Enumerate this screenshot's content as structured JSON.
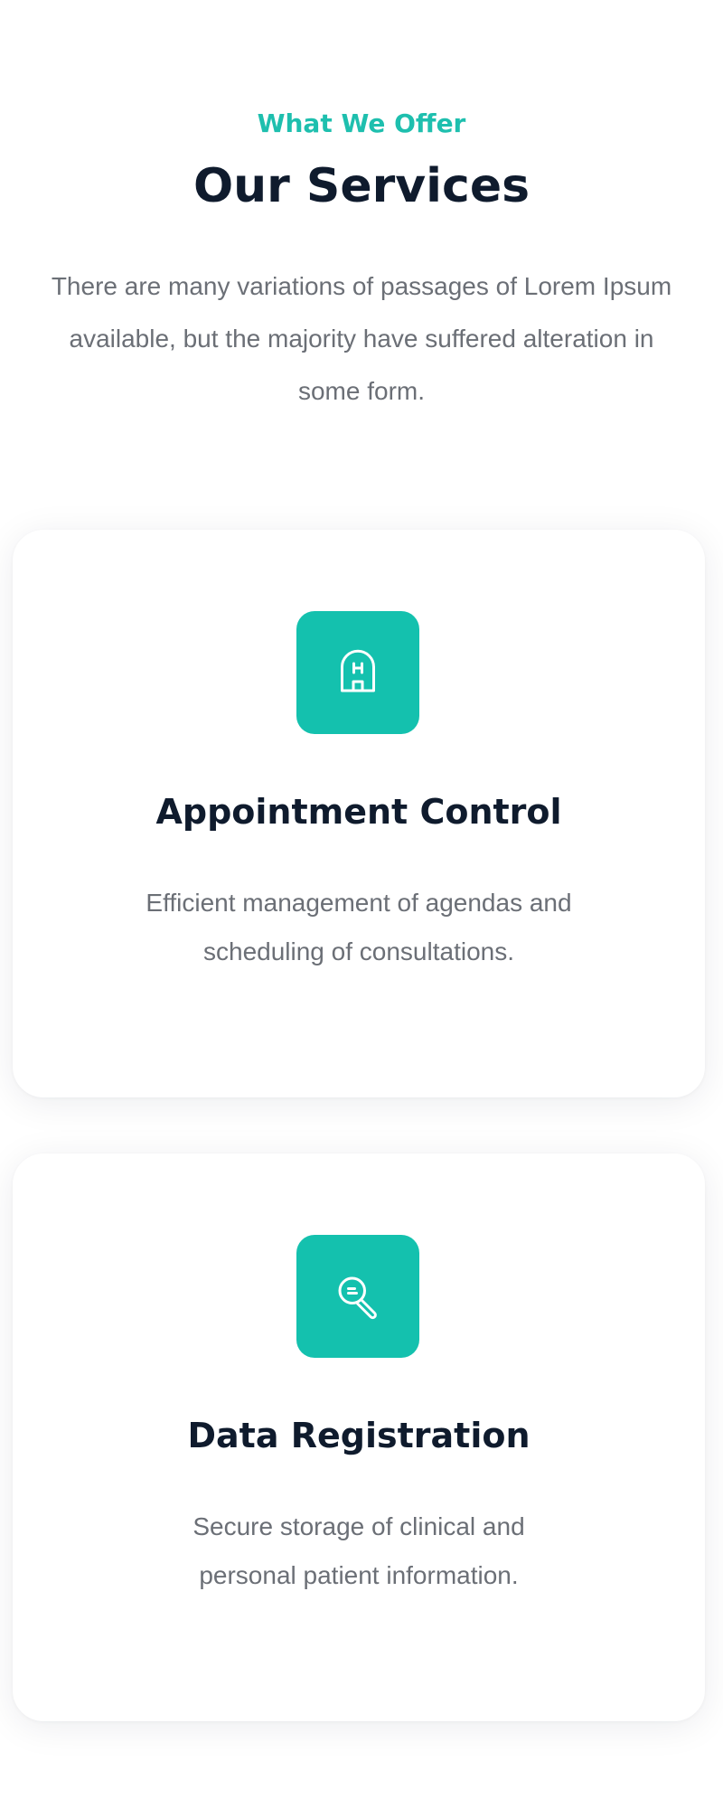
{
  "header": {
    "eyebrow": "What We Offer",
    "title": "Our Services",
    "intro": "There are many variations of passages of Lorem Ipsum available, but the majority have suffered alteration in some form."
  },
  "services": [
    {
      "icon": "hospital-icon",
      "title": "Appointment Control",
      "description": "Efficient management of agendas and scheduling of consultations."
    },
    {
      "icon": "search-icon",
      "title": "Data Registration",
      "description": "Secure storage of clinical and personal patient information."
    }
  ],
  "colors": {
    "accent": "#14c1ae",
    "heading": "#0f1b2d",
    "body_text": "#6b6f76",
    "background": "#ffffff"
  }
}
